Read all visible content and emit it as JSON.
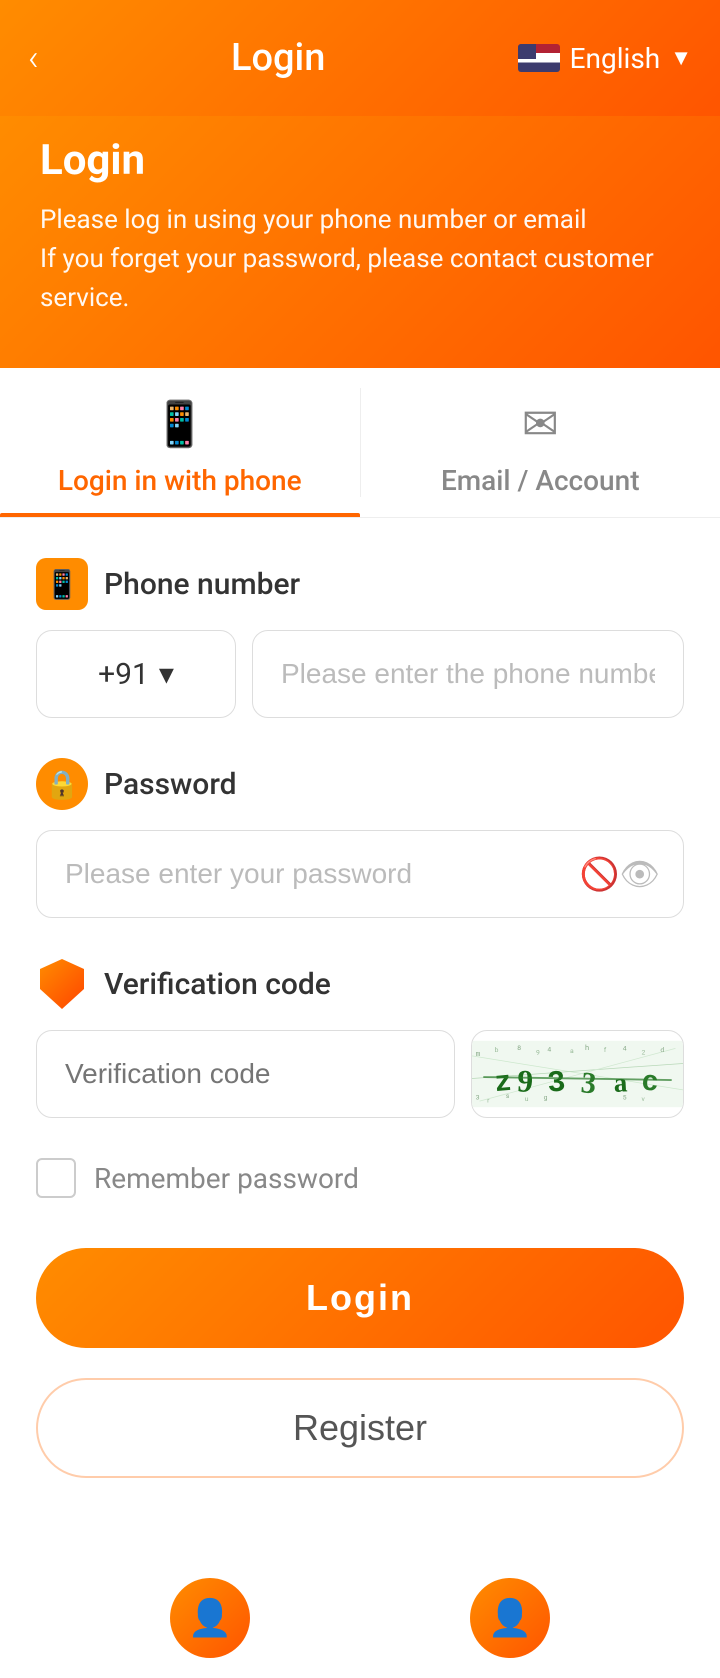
{
  "header": {
    "back_label": "‹",
    "title": "Login",
    "language": "English"
  },
  "hero": {
    "title": "Login",
    "description_line1": "Please log in using your phone number or email",
    "description_line2": "If you forget your password, please contact customer service."
  },
  "tabs": [
    {
      "id": "phone",
      "label": "Login in with phone",
      "icon": "📱",
      "active": true
    },
    {
      "id": "email",
      "label": "Email / Account",
      "icon": "✉",
      "active": false
    }
  ],
  "form": {
    "phone_section": {
      "label": "Phone number",
      "country_code": "+91",
      "phone_placeholder": "Please enter the phone number"
    },
    "password_section": {
      "label": "Password",
      "placeholder": "Please enter your password"
    },
    "verification_section": {
      "label": "Verification code",
      "placeholder": "Verification code"
    },
    "remember_label": "Remember password"
  },
  "buttons": {
    "login": "Login",
    "register": "Register"
  }
}
